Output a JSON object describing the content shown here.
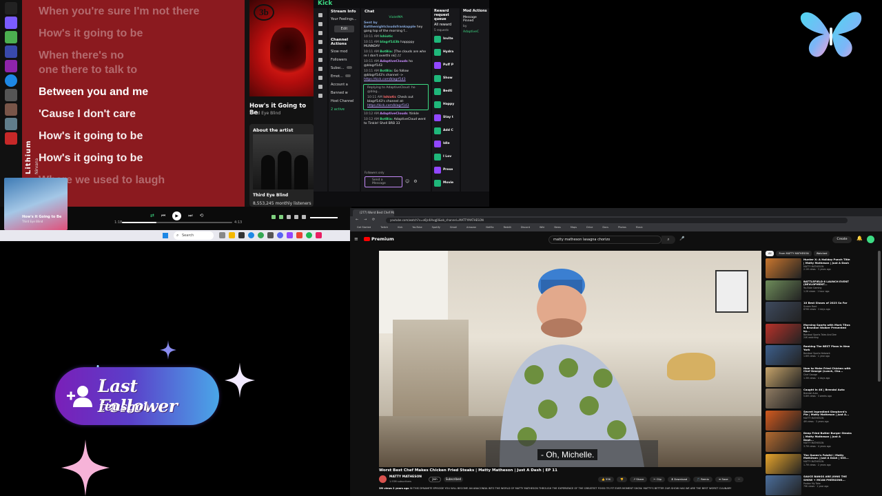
{
  "spotify": {
    "lyrics": [
      {
        "text": "When you're sure I'm not there",
        "state": "fade"
      },
      {
        "text": "How's it going to be",
        "state": "fade"
      },
      {
        "text": "When there's no\none there to talk to",
        "state": "fade"
      },
      {
        "text": "Between you and me",
        "state": "active"
      },
      {
        "text": "'Cause I don't care",
        "state": "past"
      },
      {
        "text": "How's it going to be",
        "state": "past"
      },
      {
        "text": "How's it going to be",
        "state": "past"
      },
      {
        "text": "Where we used to laugh",
        "state": "fade"
      }
    ],
    "now_playing": {
      "title": "How's it Going to Be",
      "artist": "Third Eye Blind",
      "album_logo": "3b"
    },
    "about": {
      "label": "About the artist",
      "artist_name": "Third Eye Blind",
      "listeners": "8,553,245 monthly listeners"
    },
    "player": {
      "thumb_title": "How's it Going to Be",
      "thumb_artist": "Third Eye Blind",
      "playlist_art_word": "Lithium",
      "playlist_art_sub": "Nirvana",
      "time_elapsed": "1:18",
      "time_total": "4:13",
      "progress": 0.31,
      "volume": 1.0
    }
  },
  "taskbar": {
    "search_placeholder": "Search"
  },
  "twitch": {
    "logo": "Kick",
    "stream_info": {
      "title": "Stream Info",
      "your_feelings": "Your Feelings...",
      "edit": "Edit",
      "channel_actions": "Channel Actions",
      "items": [
        "Slow mod",
        "Followers",
        "Subsc...",
        "Emot...",
        "Account a",
        "Banned w",
        "Host Channel"
      ],
      "active_label": "2 active"
    },
    "chat": {
      "title": "Chat",
      "pinned_user": "VioletMA",
      "messages": [
        {
          "ts": "",
          "user": "Sent by Eatthenightcloudsfrankapple",
          "text": "hey gang top of the morning f...",
          "link": "",
          "color": "b"
        },
        {
          "ts": "10:11 AM",
          "user": "Ishiotic",
          "text": "",
          "link": "",
          "color": "g"
        },
        {
          "ts": "10:11 AM",
          "user": "blagrf143b",
          "text": "happppy MUNNDAY",
          "link": "",
          "color": "g"
        },
        {
          "ts": "10:11 AM",
          "user": "BotBia:",
          "text": "[The clouds are whe re I don't overthi nk] ♪♪",
          "link": "",
          "color": "g"
        },
        {
          "ts": "10:11 AM",
          "user": "AdaptiveClouds",
          "text": "ho @blagrf143",
          "link": "",
          "color": "p"
        },
        {
          "ts": "10:11 AM",
          "user": "BotBia:",
          "text": "Go follow @blagrf143's channel ->",
          "link": "https://kick.com/blagrf143",
          "color": "g"
        }
      ],
      "reply": {
        "replying_to": "Replying to AdaptiveCloud: ho @blag...",
        "ts": "10:11 AM",
        "user": "Ishiotic",
        "text": "Check out blagrf143's channel at:",
        "link": "https://kick.com/blagrf143"
      },
      "messages_after": [
        {
          "ts": "10:12 AM",
          "user": "AdaptiveClouds",
          "text": "!tinkle",
          "link": "",
          "color": "p"
        },
        {
          "ts": "10:12 AM",
          "user": "BotBia:",
          "text": "AdaptiveCloud went to Tinkle! Shell BRB 33",
          "link": "",
          "color": "g"
        }
      ],
      "followers_only": "Followers only",
      "input_placeholder": "Send a Message"
    },
    "reward_queue": {
      "title": "Reward request queue",
      "all_rewards": "All reward",
      "count": "5 requests",
      "items": [
        "Invite",
        "Hydra",
        "Puff P",
        "Show",
        "Bedti",
        "Happy",
        "Stay t",
        "Add C",
        "Idle",
        "I Lov",
        "Prese",
        "Movie"
      ]
    },
    "mod_actions": {
      "title": "Mod Actions",
      "pinned_title": "Message Pinned",
      "pinned_by": "by",
      "pinned_user": "AdaptiveC"
    }
  },
  "follower_widget": {
    "label": "Last Follower",
    "name": "teusgol"
  },
  "youtube": {
    "tab_title": "(277) Worst Best Chef Ma...",
    "url": "youtube.com/watch?v=o6Jc4lAxgJ0&ab_channel=MATTYMATHESON",
    "bookmarks": [
      "Get Started",
      "Twitch",
      "Kick",
      "YouTube",
      "Spotify",
      "Gmail",
      "Amazon",
      "Netflix",
      "Reddit",
      "Discord",
      "Wiki",
      "News",
      "Maps",
      "Drive",
      "Docs",
      "Photos",
      "Music"
    ],
    "logo": "Premium",
    "search_value": "matty matheson lasagna chorizo",
    "create_label": "Create",
    "subtitle": "- Oh, Michelle.",
    "video_title": "Worst Best Chef Makes Chicken Fried Steaks | Matty Matheson | Just A Dash | EP 11",
    "channel_name": "MATTY MATHESON",
    "channel_subs": "1.93M subscribers",
    "join_label": "Join",
    "subscribed_label": "Subscribed",
    "actions": [
      "👍 55K",
      "👎",
      "↗ Share",
      "✂ Clip",
      "⬇ Download",
      "🎵 Remix",
      "≡ Save",
      "···"
    ],
    "description_meta": "3M views 2 years ago",
    "description": "IN THIS DYNAMITE EPISODE YOU WILL BECOME AN ANACONDA INTO THE WORLD OF MATTY MATHESON THROUGH THE EXPERIENCE OF THE GREATEST FOOD ITS FIT EVER MOMENT SHOW. MATTY'S BETTER OUR SHOW HAS WE ARE THE BEST WORST CULINARY",
    "chips": [
      {
        "label": "All",
        "active": true
      },
      {
        "label": "From MATTY MATHESON",
        "active": false
      },
      {
        "label": "Watched",
        "active": false
      }
    ],
    "recommendations": [
      {
        "title": "Hunter X: A Holiday Punch Title | Matty Matheson | Just A Dash",
        "channel": "MATTY MATHESON",
        "meta": "2.1M views · 3 years ago",
        "color": "#c9762e"
      },
      {
        "title": "BATTLEFIELD 6 LAUNCH EVENT (DEVLOPMENT...",
        "channel": "YouTube Gaming",
        "meta": "1.2K views · 1 hour ago",
        "color": "#6e8c5a"
      },
      {
        "title": "10 Best Shows of 2023 So Far",
        "channel": "Screen Rant",
        "meta": "870K views · 2 days ago",
        "color": "#3e4a5e"
      },
      {
        "title": "Morning Sports with Mark Titus & Brandon Walker Presented by...",
        "channel": "Barstool Sports Tales And Dee",
        "meta": "24K watching",
        "color": "#b8322a"
      },
      {
        "title": "Ranking The BEST Pizza In New York",
        "channel": "Barstool Sports Network",
        "meta": "1.6M views · 1 year ago",
        "color": "#3d5f8c"
      },
      {
        "title": "How to Make Fried Chicken with Chef George (Lunch, Cha...",
        "channel": "Chef George",
        "meta": "1.3M views · 4 days ago",
        "color": "#c5a36a"
      },
      {
        "title": "Caught In 4K | Brendal Auto",
        "channel": "Brendal Auto",
        "meta": "5.8M views · 3 weeks ago",
        "color": "#8f7b62"
      },
      {
        "title": "Secret Ingredient Shepherd's Pie | Matty Matheson | Just A...",
        "channel": "MATTY MATHESON",
        "meta": "4M views · 3 years ago",
        "color": "#d35a1e"
      },
      {
        "title": "Deep Fried Butter Burger Steaks | Matty Matheson | Just A Dash...",
        "channel": "MATTY MATHESON",
        "meta": "3.7M views · 4 years ago",
        "color": "#b36a2f"
      },
      {
        "title": "The Queen's Falafel | Matty Matheson | Just A Dash | S03...",
        "channel": "MATTY MATHESON",
        "meta": "1.7M views · 2 years ago",
        "color": "#e6a42c"
      },
      {
        "title": "SAUCE BANGS ARE JOINS THE SHOW + MCAN PHERSONS...",
        "channel": "Pardon My Take",
        "meta": "79K views · 1 year ago",
        "color": "#4b6e9c"
      }
    ]
  },
  "colors": {
    "spotify_bg": "#8b1a1f",
    "twitch_green": "#3ddc84",
    "twitch_purple": "#9147ff",
    "yt_red": "#ff0000",
    "follower_grad_start": "#7a1fb8",
    "follower_grad_end": "#4aa6e8"
  }
}
